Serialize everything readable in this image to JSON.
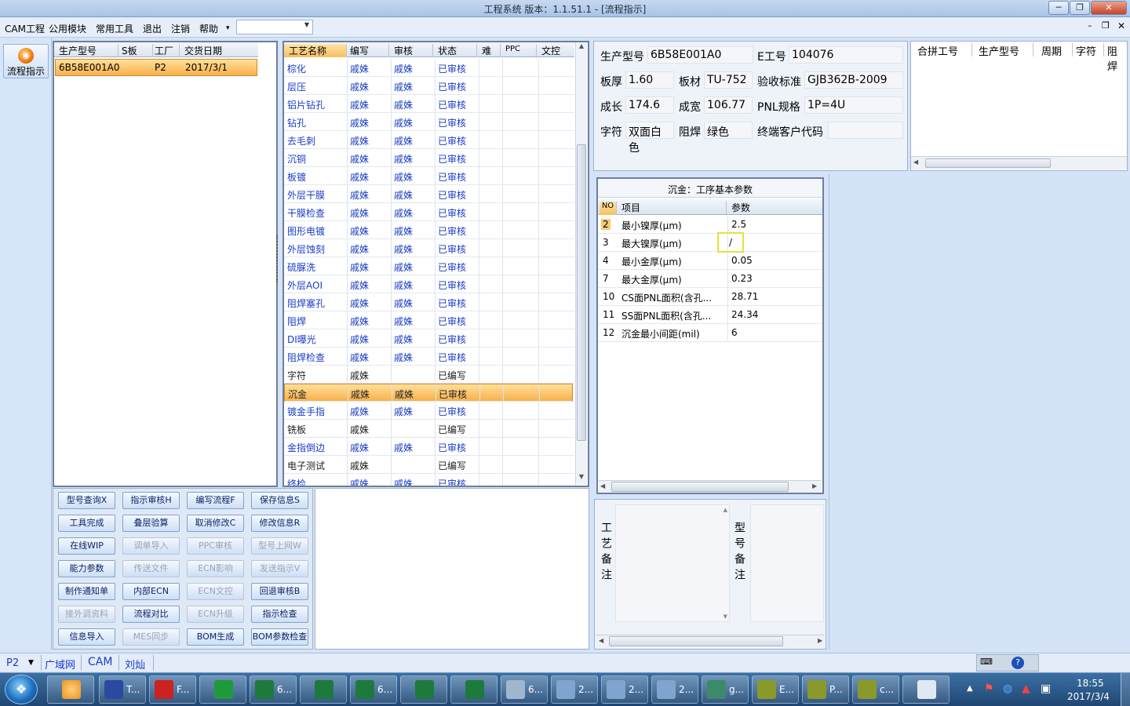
{
  "window": {
    "title": "工程系统    版本：1.1.51.1 - [流程指示]"
  },
  "menu": [
    "CAM工程",
    "公用模块",
    "常用工具",
    "退出",
    "注销",
    "帮助"
  ],
  "sidebar": {
    "flow_label": "流程指示"
  },
  "orders": {
    "headers": [
      "生产型号",
      "S板",
      "工厂",
      "交货日期"
    ],
    "rows": [
      {
        "model": "6B58E001A0",
        "sboard": "",
        "factory": "P2",
        "date": "2017/3/1"
      }
    ]
  },
  "process": {
    "headers": [
      "工艺名称",
      "编写",
      "审核",
      "状态",
      "难",
      "PPC",
      "文控"
    ],
    "selected_index": 18,
    "rows": [
      {
        "name": "棕化",
        "writer": "戚姝",
        "reviewer": "戚姝",
        "status": "已审核"
      },
      {
        "name": "层压",
        "writer": "戚姝",
        "reviewer": "戚姝",
        "status": "已审核"
      },
      {
        "name": "铝片钻孔",
        "writer": "戚姝",
        "reviewer": "戚姝",
        "status": "已审核"
      },
      {
        "name": "钻孔",
        "writer": "戚姝",
        "reviewer": "戚姝",
        "status": "已审核"
      },
      {
        "name": "去毛刺",
        "writer": "戚姝",
        "reviewer": "戚姝",
        "status": "已审核"
      },
      {
        "name": "沉铜",
        "writer": "戚姝",
        "reviewer": "戚姝",
        "status": "已审核"
      },
      {
        "name": "板镀",
        "writer": "戚姝",
        "reviewer": "戚姝",
        "status": "已审核"
      },
      {
        "name": "外层干膜",
        "writer": "戚姝",
        "reviewer": "戚姝",
        "status": "已审核"
      },
      {
        "name": "干膜检查",
        "writer": "戚姝",
        "reviewer": "戚姝",
        "status": "已审核"
      },
      {
        "name": "图形电镀",
        "writer": "戚姝",
        "reviewer": "戚姝",
        "status": "已审核"
      },
      {
        "name": "外层蚀刻",
        "writer": "戚姝",
        "reviewer": "戚姝",
        "status": "已审核"
      },
      {
        "name": "硫脲洗",
        "writer": "戚姝",
        "reviewer": "戚姝",
        "status": "已审核"
      },
      {
        "name": "外层AOI",
        "writer": "戚姝",
        "reviewer": "戚姝",
        "status": "已审核"
      },
      {
        "name": "阻焊塞孔",
        "writer": "戚姝",
        "reviewer": "戚姝",
        "status": "已审核"
      },
      {
        "name": "阻焊",
        "writer": "戚姝",
        "reviewer": "戚姝",
        "status": "已审核"
      },
      {
        "name": "DI曝光",
        "writer": "戚姝",
        "reviewer": "戚姝",
        "status": "已审核"
      },
      {
        "name": "阻焊检查",
        "writer": "戚姝",
        "reviewer": "戚姝",
        "status": "已审核"
      },
      {
        "name": "字符",
        "writer": "戚姝",
        "reviewer": "",
        "status": "已编写"
      },
      {
        "name": "沉金",
        "writer": "戚姝",
        "reviewer": "戚姝",
        "status": "已审核"
      },
      {
        "name": "镀金手指",
        "writer": "戚姝",
        "reviewer": "戚姝",
        "status": "已审核"
      },
      {
        "name": "铣板",
        "writer": "戚姝",
        "reviewer": "",
        "status": "已编写"
      },
      {
        "name": "金指倒边",
        "writer": "戚姝",
        "reviewer": "戚姝",
        "status": "已审核"
      },
      {
        "name": "电子测试",
        "writer": "戚姝",
        "reviewer": "",
        "status": "已编写"
      },
      {
        "name": "终检",
        "writer": "戚姝",
        "reviewer": "戚姝",
        "status": "已审核"
      }
    ]
  },
  "buttons": [
    [
      "型号查询X",
      "指示审核H",
      "编写流程F",
      "保存信息S"
    ],
    [
      "工具完成",
      "叠层验算",
      "取消修改C",
      "修改信息R"
    ],
    [
      "在线WIP",
      "调单导入",
      "PPC审核",
      "型号上网W"
    ],
    [
      "能力参数",
      "传送文件",
      "ECN影响",
      "发送指示V"
    ],
    [
      "制作通知单",
      "内部ECN",
      "ECN文控",
      "回退审核B"
    ],
    [
      "接外调资料",
      "流程对比",
      "ECN升级",
      "指示检查"
    ],
    [
      "信息导入",
      "MES同步",
      "BOM生成",
      "BOM参数检查"
    ]
  ],
  "buttons_disabled": [
    "调单导入",
    "PPC审核",
    "型号上网W",
    "传送文件",
    "ECN影响",
    "发送指示V",
    "ECN文控",
    "接外调资料",
    "ECN升级",
    "MES同步"
  ],
  "info": {
    "model_label": "生产型号",
    "model": "6B58E001A0",
    "e_label": "E工号",
    "e_no": "104076",
    "thick_label": "板厚",
    "thick": "1.60",
    "mat_label": "板材",
    "mat": "TU-752",
    "std_label": "验收标准",
    "std": "GJB362B-2009",
    "len_label": "成长",
    "len": "174.6",
    "wid_label": "成宽",
    "wid": "106.77",
    "pnl_label": "PNL规格",
    "pnl": "1P=4U",
    "char_label": "字符",
    "char": "双面白色",
    "mask_label": "阻焊",
    "mask": "绿色",
    "cust_label": "终端客户代码",
    "cust": ""
  },
  "merge": {
    "headers": [
      "合拼工号",
      "生产型号",
      "周期",
      "字符",
      "阻焊"
    ]
  },
  "params": {
    "title": "沉金：工序基本参数",
    "headers": [
      "NO",
      "项目",
      "参数"
    ],
    "rows": [
      {
        "no": "2",
        "item": "最小镍厚(μm)",
        "val": "2.5"
      },
      {
        "no": "3",
        "item": "最大镍厚(μm)",
        "val": "/"
      },
      {
        "no": "4",
        "item": "最小金厚(μm)",
        "val": "0.05"
      },
      {
        "no": "7",
        "item": "最大金厚(μm)",
        "val": "0.23"
      },
      {
        "no": "10",
        "item": "CS面PNL面积(含孔...",
        "val": "28.71"
      },
      {
        "no": "11",
        "item": "SS面PNL面积(含孔...",
        "val": "24.34"
      },
      {
        "no": "12",
        "item": "沉金最小间距(mil)",
        "val": "6"
      }
    ]
  },
  "notes": {
    "process_label": "工艺备注",
    "model_label": "型号备注"
  },
  "status": {
    "factory": "P2",
    "net": "广域网",
    "dept": "CAM",
    "user": "刘灿"
  },
  "taskbar": {
    "items": [
      {
        "label": "T...",
        "color": "#2a4aa0"
      },
      {
        "label": "F...",
        "color": "#cc2222"
      },
      {
        "label": "",
        "color": "#1f9a3a"
      },
      {
        "label": "6...",
        "color": "#1d7a3c"
      },
      {
        "label": "",
        "color": "#1d7a3c"
      },
      {
        "label": "6...",
        "color": "#1d7a3c"
      },
      {
        "label": "",
        "color": "#1d7a3c"
      },
      {
        "label": "",
        "color": "#1d7a3c"
      },
      {
        "label": "6...",
        "color": "#9fb6cf"
      },
      {
        "label": "2...",
        "color": "#7fa5cf"
      },
      {
        "label": "2...",
        "color": "#7fa5cf"
      },
      {
        "label": "2...",
        "color": "#7fa5cf"
      },
      {
        "label": "g...",
        "color": "#3c8a6a"
      },
      {
        "label": "E...",
        "color": "#8a9a2a"
      },
      {
        "label": "P...",
        "color": "#8a9a2a"
      },
      {
        "label": "c...",
        "color": "#8a9a2a"
      },
      {
        "label": "",
        "color": "#dfe8f3"
      }
    ],
    "time": "18:55",
    "date": "2017/3/4"
  }
}
